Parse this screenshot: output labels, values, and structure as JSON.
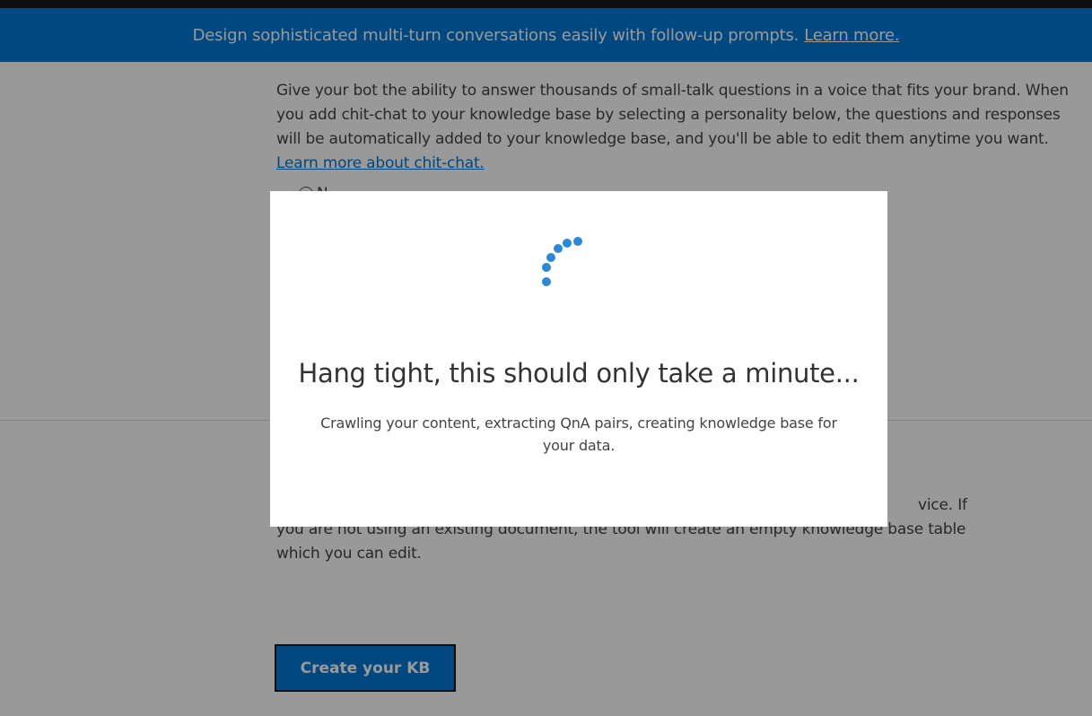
{
  "banner": {
    "text": "Design sophisticated multi-turn conversations easily with follow-up prompts.",
    "link": "Learn more."
  },
  "chit_chat": {
    "description": "Give your bot the ability to answer thousands of small-talk questions in a voice that fits your brand. When you add chit-chat to your knowledge base by selecting a personality below, the questions and responses will be automatically added to your knowledge base, and you'll be able to edit them anytime you want.",
    "link": "Learn more about chit-chat.",
    "option_partial": "N"
  },
  "step5": {
    "description": "vice. If you are not using an existing document, the tool will create an empty knowledge base table which you can edit."
  },
  "create_button": "Create your KB",
  "modal": {
    "title": "Hang tight, this should only take a minute...",
    "text": "Crawling your content, extracting QnA pairs, creating knowledge base for your data."
  },
  "colors": {
    "accent": "#0078d4",
    "spinner": "#2b88d8"
  }
}
